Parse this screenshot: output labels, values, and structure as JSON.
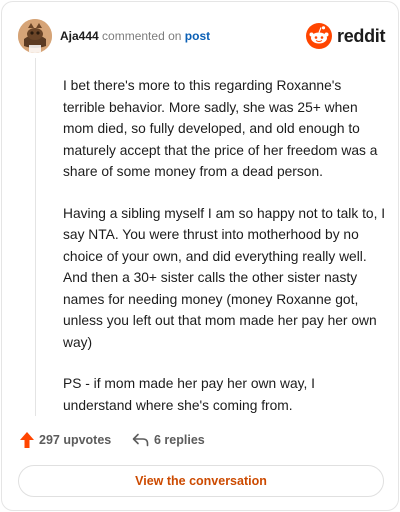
{
  "comment": {
    "author": "Aja444",
    "action_text": "commented on",
    "post_link": "post",
    "brand": "reddit",
    "paragraphs": [
      "I bet there's more to this regarding Roxanne's terrible behavior. More sadly, she was 25+ when mom died, so fully developed, and old enough to maturely accept that the price of her freedom was a share of some money from a dead person.",
      "Having a sibling myself I am so happy not to talk to, I say NTA. You were thrust into motherhood by no choice of your own, and did everything really well. And then a 30+ sister calls the other sister nasty names for needing money (money Roxanne got, unless you left out that mom made her pay her own way)",
      "PS - if mom made her pay her own way, I understand where she's coming from."
    ]
  },
  "actions": {
    "upvotes": "297 upvotes",
    "replies": "6 replies"
  },
  "footer": {
    "view_label": "View the conversation"
  },
  "colors": {
    "upvote": "#ff4500",
    "link": "#0a5fb5",
    "cta": "#cc4a00"
  }
}
